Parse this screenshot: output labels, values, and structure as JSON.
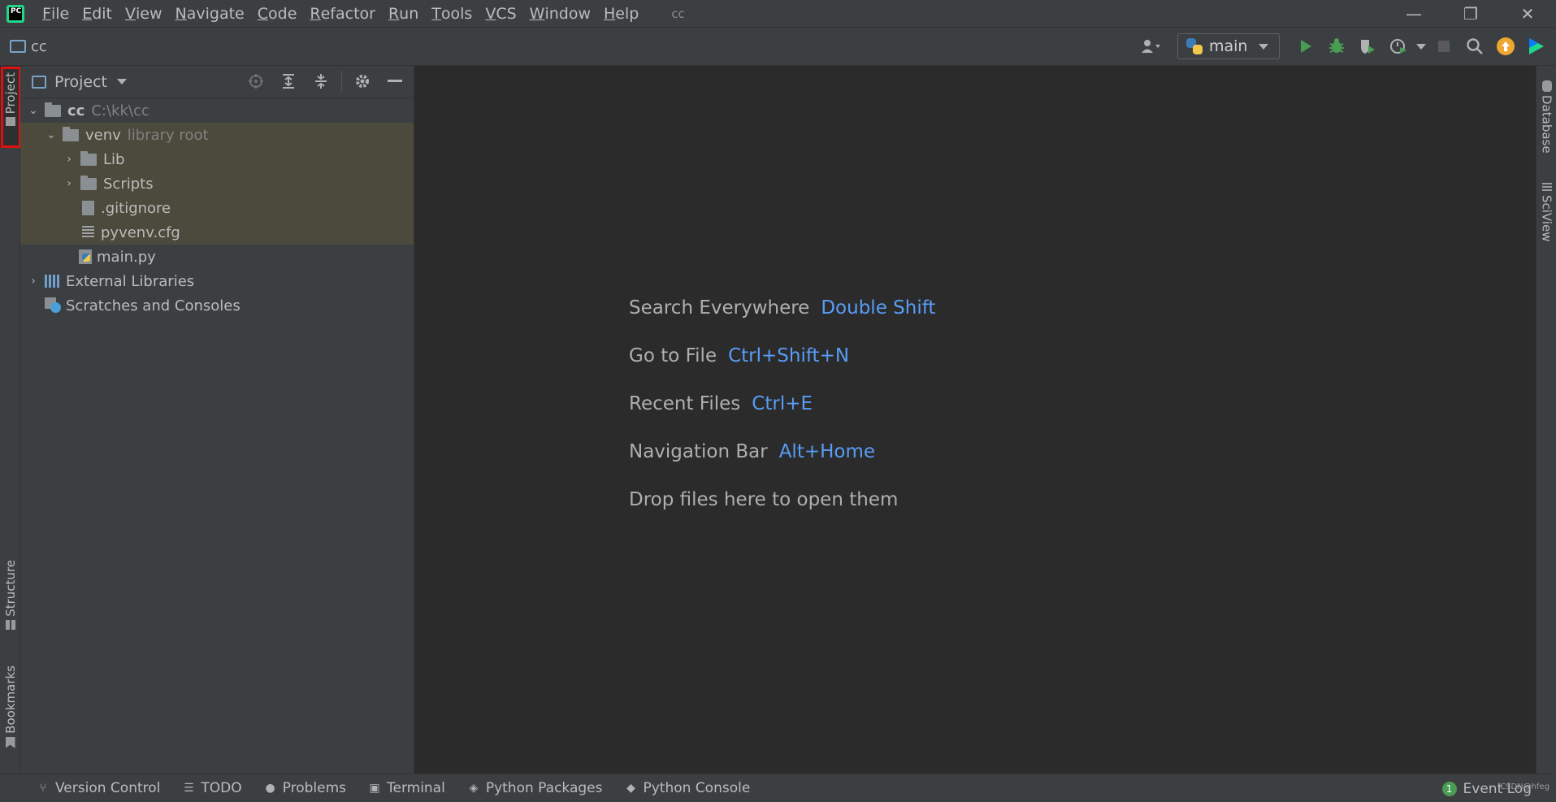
{
  "app": {
    "logo_text": "PC",
    "window_title": "cc"
  },
  "menu": [
    {
      "label": "File",
      "mnemonic": "F",
      "rest": "ile"
    },
    {
      "label": "Edit",
      "mnemonic": "E",
      "rest": "dit"
    },
    {
      "label": "View",
      "mnemonic": "V",
      "rest": "iew"
    },
    {
      "label": "Navigate",
      "mnemonic": "N",
      "rest": "avigate"
    },
    {
      "label": "Code",
      "mnemonic": "C",
      "rest": "ode"
    },
    {
      "label": "Refactor",
      "mnemonic": "R",
      "rest": "efactor"
    },
    {
      "label": "Run",
      "mnemonic": "R",
      "rest": "un"
    },
    {
      "label": "Tools",
      "mnemonic": "T",
      "rest": "ools"
    },
    {
      "label": "VCS",
      "mnemonic": "V",
      "rest": "CS"
    },
    {
      "label": "Window",
      "mnemonic": "W",
      "rest": "indow"
    },
    {
      "label": "Help",
      "mnemonic": "H",
      "rest": "elp"
    }
  ],
  "window_controls": {
    "minimize": "—",
    "restore": "❐",
    "close": "✕"
  },
  "navbar": {
    "crumb": "cc"
  },
  "toolbar": {
    "run_config": "main",
    "icons": [
      "user-icon",
      "run-icon",
      "debug-icon",
      "coverage-icon",
      "profile-icon",
      "stop-icon",
      "search-icon",
      "update-icon",
      "jetbrains-toolbox-icon"
    ],
    "colors": {
      "run": "#499c54",
      "stop": "#5a5a5a",
      "update": "#f0a732"
    }
  },
  "left_stripe": {
    "project": "Project",
    "structure": "Structure",
    "bookmarks": "Bookmarks"
  },
  "right_stripe": {
    "database": "Database",
    "sciview": "SciView"
  },
  "project_panel": {
    "title": "Project",
    "tree": [
      {
        "name": "cc",
        "hint": "C:\\kk\\cc"
      },
      {
        "name": "venv",
        "hint": "library root"
      },
      {
        "name": "Lib"
      },
      {
        "name": "Scripts"
      },
      {
        "name": ".gitignore"
      },
      {
        "name": "pyvenv.cfg"
      },
      {
        "name": "main.py"
      },
      {
        "name": "External Libraries"
      },
      {
        "name": "Scratches and Consoles"
      }
    ]
  },
  "editor": {
    "hints": [
      {
        "label": "Search Everywhere",
        "key": "Double Shift"
      },
      {
        "label": "Go to File",
        "key": "Ctrl+Shift+N"
      },
      {
        "label": "Recent Files",
        "key": "Ctrl+E"
      },
      {
        "label": "Navigation Bar",
        "key": "Alt+Home"
      },
      {
        "label": "Drop files here to open them",
        "key": ""
      }
    ],
    "colors": {
      "label": "#afafaf",
      "key": "#589df6"
    }
  },
  "bottom_bar": {
    "version_control": "Version Control",
    "todo": "TODO",
    "problems": "Problems",
    "terminal": "Terminal",
    "python_packages": "Python Packages",
    "python_console": "Python Console",
    "event_log": "Event Log",
    "event_count": "1",
    "watermark": "CSDN@hfeg"
  }
}
